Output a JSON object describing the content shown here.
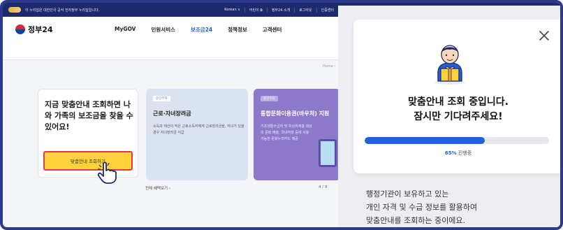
{
  "topbar": {
    "notice": "이 누리집은 대한민국 공식 전자정부 누리집입니다.",
    "links": [
      "Korean ∨",
      "어린이 ⧉",
      "정부24 소개",
      "로그아웃",
      "인증센터"
    ]
  },
  "header": {
    "logo_text": "정부24",
    "nav": [
      {
        "label": "MyGOV",
        "active": false
      },
      {
        "label": "민원서비스",
        "active": false
      },
      {
        "label": "보조금24",
        "active": true
      },
      {
        "label": "정책정보",
        "active": false
      },
      {
        "label": "고객센터",
        "active": false
      }
    ]
  },
  "breadcrumb": "Home ›",
  "hero": {
    "title": "지금 맞춤안내 조회하면 나와 가족의 보조금을 찾을 수 있어요!",
    "button_label": "맞춤안내 조회하기"
  },
  "cards": [
    {
      "tag": "중앙부처",
      "title": "근로·자녀장려금",
      "desc": "소득과 재산이 적은 근로소득자에게 근로장려금을, 자녀가 있을 경우 자녀장려금 지급"
    },
    {
      "tag": "중앙부처",
      "title": "통합문화이용권(바우처) 지원",
      "desc": "기초생활수급자 및 차상위계층 대상의 문화 예술, 국내여행 등에 사용 가능한 문화누리카드 제공"
    }
  ],
  "more_link": "전체 혜택보기  ›",
  "pager": "4 / 9",
  "modal": {
    "title_line1": "맞춤안내 조회 중입니다.",
    "title_line2": "잠시만 기다려주세요!",
    "progress_percent": 65,
    "progress_pct_text": "65%",
    "progress_suffix": " 진행중"
  },
  "info": {
    "line1": "행정기관이 보유하고 있는",
    "line2": "개인 자격 및 수급 정보를 활용하여",
    "line3": "맞춤안내를 조회하는 중이에요."
  },
  "colors": {
    "brand_navy": "#1c2a6e",
    "accent_blue": "#1f63d6",
    "button_yellow": "#ffd23a",
    "highlight_red": "#e23a4a"
  },
  "icons": [
    "gov-mark-icon",
    "taeguk-icon",
    "hand-pointer-icon",
    "close-icon",
    "mascot-gift-icon"
  ]
}
